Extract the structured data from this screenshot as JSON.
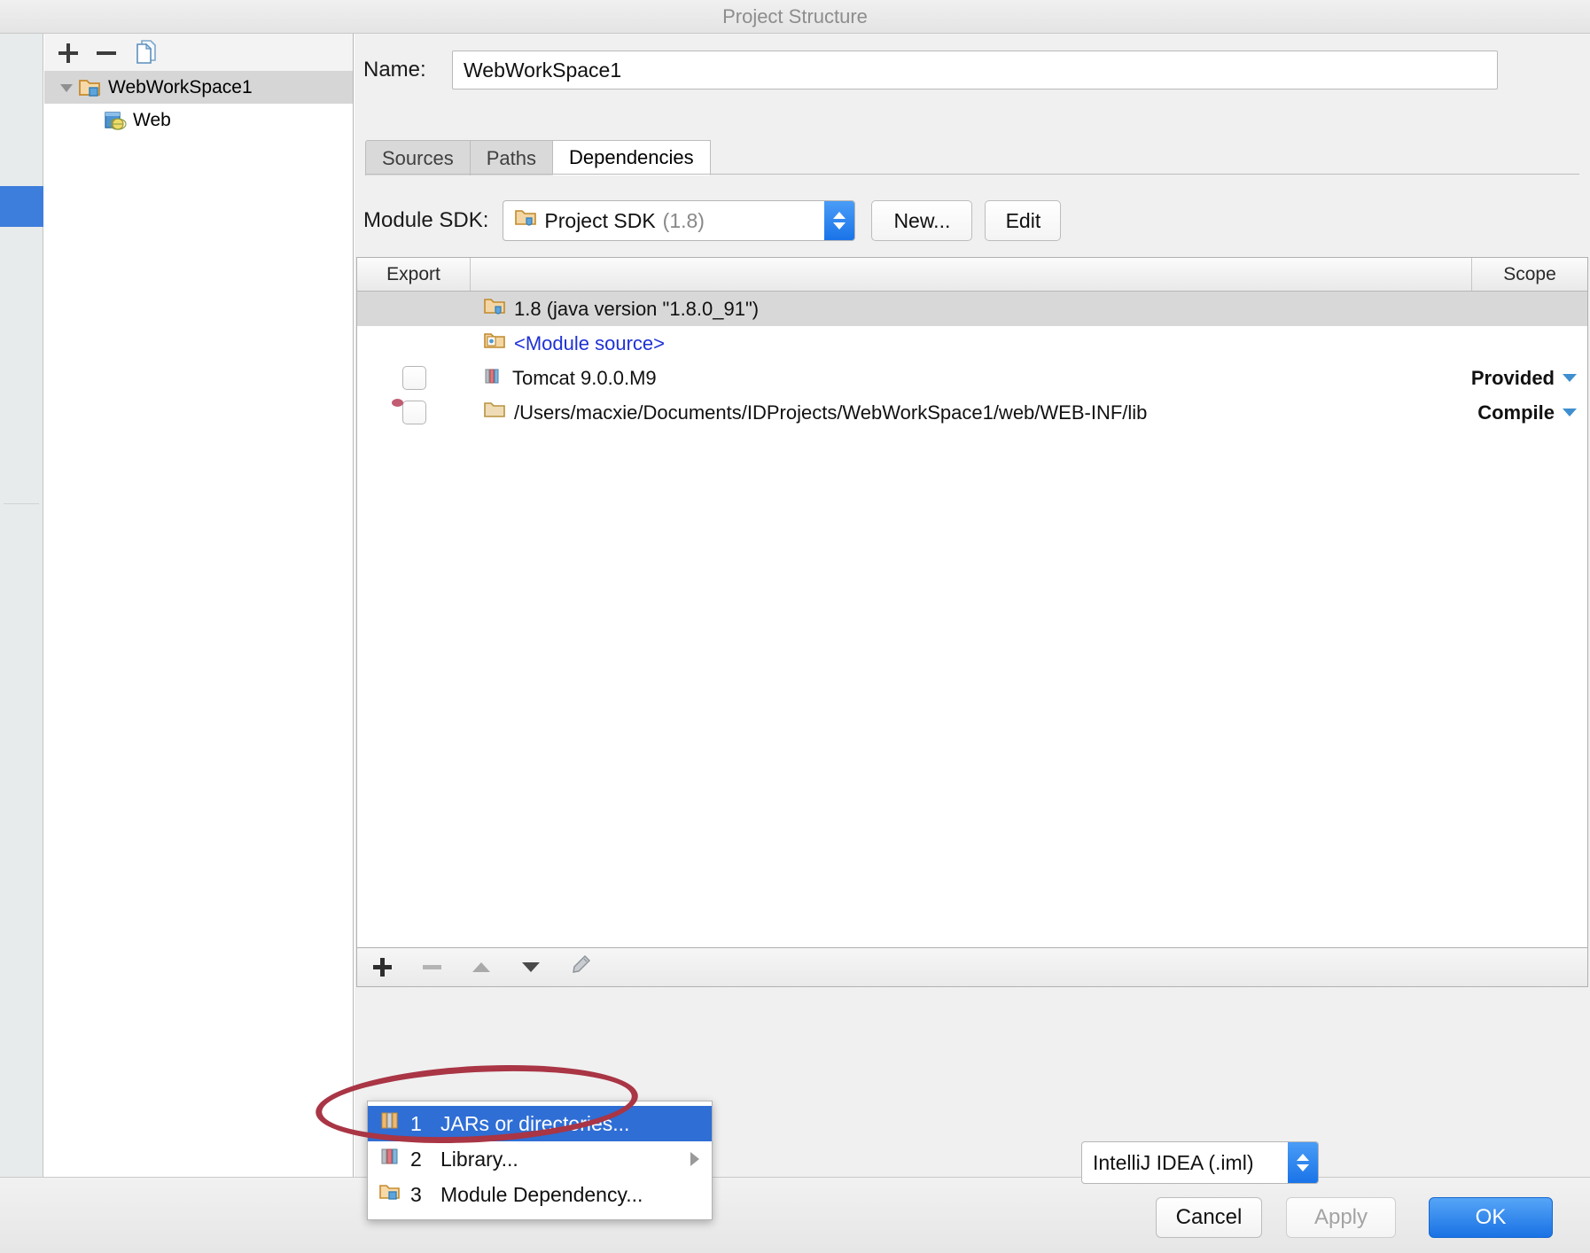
{
  "window": {
    "title": "Project Structure"
  },
  "sidebar": {
    "toolbar": [
      {
        "name": "add-module-button",
        "icon": "plus-icon",
        "label": "+"
      },
      {
        "name": "remove-module-button",
        "icon": "minus-icon",
        "label": "−"
      },
      {
        "name": "copy-module-button",
        "icon": "copy-icon",
        "label": "Copy"
      }
    ],
    "tree": [
      {
        "label": "WebWorkSpace1",
        "icon": "module-folder-icon",
        "level": 0,
        "selected": true,
        "expanded": true
      },
      {
        "label": "Web",
        "icon": "web-facet-icon",
        "level": 1,
        "selected": false
      }
    ]
  },
  "main": {
    "name_field": {
      "label": "Name:",
      "value": "WebWorkSpace1",
      "placeholder": "Module name"
    },
    "tabs": [
      {
        "label": "Sources",
        "active": false
      },
      {
        "label": "Paths",
        "active": false
      },
      {
        "label": "Dependencies",
        "active": true
      }
    ],
    "sdk": {
      "label": "Module SDK:",
      "value": "Project SDK",
      "version": "(1.8)",
      "new_button": "New...",
      "edit_button": "Edit"
    },
    "table": {
      "columns": [
        "Export",
        "",
        "Scope"
      ],
      "rows": [
        {
          "export_checkbox": false,
          "checkbox_visible": false,
          "icon": "jdk-folder-icon",
          "name": "1.8 (java version \"1.8.0_91\")",
          "scope": "",
          "scope_caret": false,
          "selected": true,
          "link": false
        },
        {
          "export_checkbox": false,
          "checkbox_visible": false,
          "icon": "module-source-icon",
          "name": "<Module source>",
          "scope": "",
          "scope_caret": false,
          "selected": false,
          "link": true
        },
        {
          "export_checkbox": false,
          "checkbox_visible": true,
          "icon": "library-icon",
          "name": "Tomcat 9.0.0.M9",
          "scope": "Provided",
          "scope_caret": true,
          "selected": false,
          "link": false
        },
        {
          "export_checkbox": false,
          "checkbox_visible": true,
          "icon": "folder-icon",
          "name": "/Users/macxie/Documents/IDProjects/WebWorkSpace1/web/WEB-INF/lib",
          "scope": "Compile",
          "scope_caret": true,
          "selected": false,
          "link": false
        }
      ]
    },
    "table_toolbar": [
      {
        "name": "add-dependency-button",
        "icon": "plus-icon"
      },
      {
        "name": "remove-dependency-button",
        "icon": "minus-icon"
      },
      {
        "name": "move-up-button",
        "icon": "triangle-up-icon"
      },
      {
        "name": "move-down-button",
        "icon": "triangle-down-icon"
      },
      {
        "name": "edit-dependency-button",
        "icon": "pencil-icon"
      }
    ],
    "context_menu": [
      {
        "number": "1",
        "label": "JARs or directories...",
        "icon": "jars-icon",
        "selected": true,
        "submenu": false
      },
      {
        "number": "2",
        "label": "Library...",
        "icon": "library-icon",
        "selected": false,
        "submenu": true
      },
      {
        "number": "3",
        "label": "Module Dependency...",
        "icon": "module-folder-icon",
        "selected": false,
        "submenu": false
      }
    ],
    "format_combo": {
      "value": "IntelliJ IDEA (.iml)"
    }
  },
  "footer": {
    "cancel": "Cancel",
    "apply": "Apply",
    "ok": "OK"
  },
  "colors": {
    "accent": "#2f6ed5",
    "ok_button": "#1a72e4",
    "annotation": "#a93545",
    "link": "#1f31d6"
  }
}
